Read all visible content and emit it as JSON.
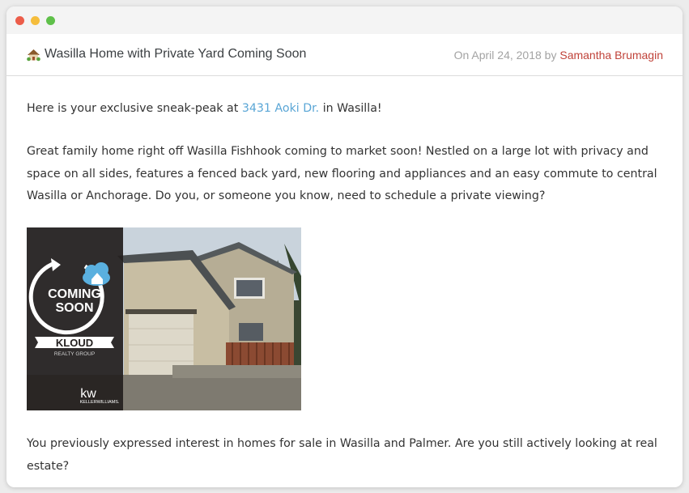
{
  "window": {
    "controls": [
      "close",
      "minimize",
      "maximize"
    ]
  },
  "email": {
    "subject": "Wasilla Home with Private Yard Coming Soon",
    "subject_icon": "house-with-garden-icon",
    "date_prefix": "On April 24, 2018 by",
    "author": "Samantha Brumagin",
    "intro_before": "Here is your exclusive sneak-peak at",
    "address_link": "3431 Aoki Dr.",
    "intro_after": "in Wasilla!",
    "paragraph2": "Great family home right off Wasilla Fishhook coming to market soon! Nestled on a large lot with privacy and space on all sides, features a fenced back yard, new flooring and appliances and an easy commute to central Wasilla or Anchorage. Do you, or someone you know, need to schedule a private viewing?",
    "image": {
      "badge_line1": "COMING",
      "badge_line2": "SOON",
      "brand": "KLOUD",
      "brand_sub": "REALTY GROUP",
      "kw_logo": "kw",
      "kw_sub": "KELLERWILLIAMS."
    },
    "paragraph3": "You previously expressed interest in homes for sale in Wasilla and Palmer. Are you still actively looking at real estate?"
  },
  "colors": {
    "link": "#5aa6d6",
    "author": "#c0433a",
    "close": "#ec5d4a",
    "minimize": "#f5bd3c",
    "maximize": "#5fc04a"
  }
}
